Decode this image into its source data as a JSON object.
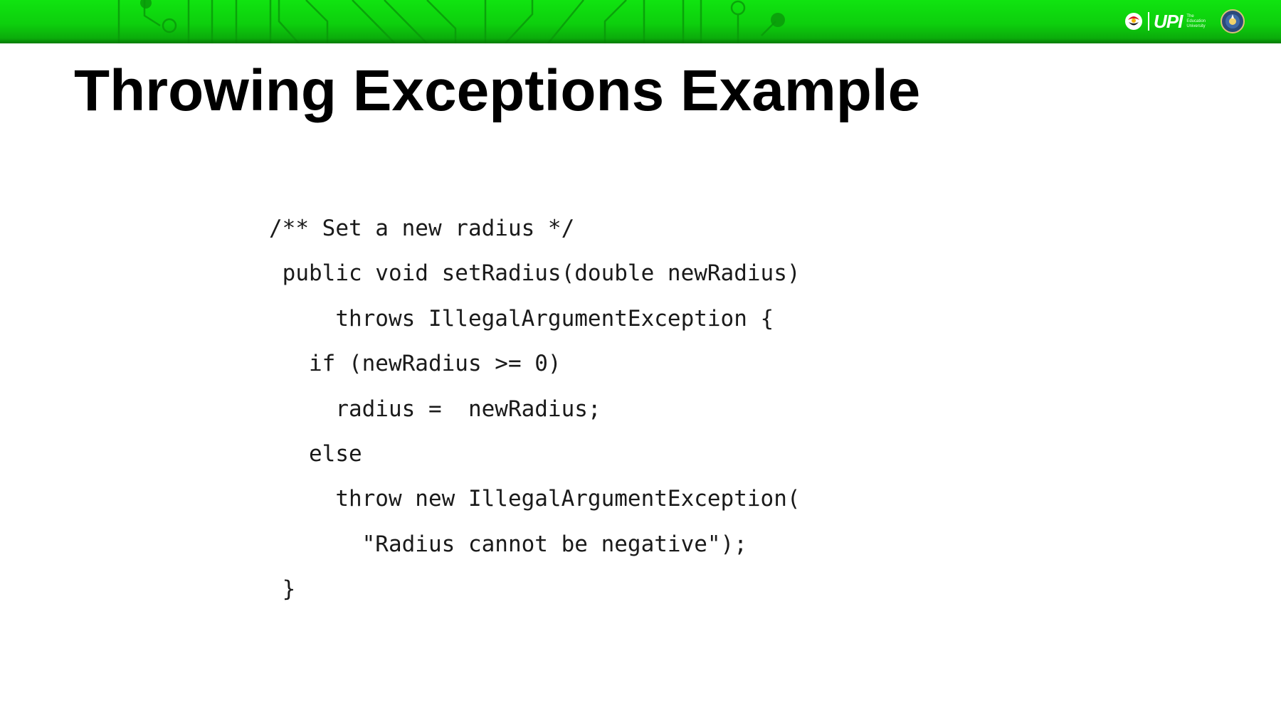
{
  "slide": {
    "title": "Throwing Exceptions Example"
  },
  "header": {
    "logo_text": "UPI",
    "logo_tagline": [
      "The",
      "Education",
      "University"
    ],
    "banner_color": "#0dcf0d"
  },
  "code": {
    "lines": [
      "/** Set a new radius */",
      " public void setRadius(double newRadius)",
      "     throws IllegalArgumentException {",
      "   if (newRadius >= 0)",
      "     radius =  newRadius;",
      "   else",
      "     throw new IllegalArgumentException(",
      "       \"Radius cannot be negative\");",
      " }"
    ]
  }
}
